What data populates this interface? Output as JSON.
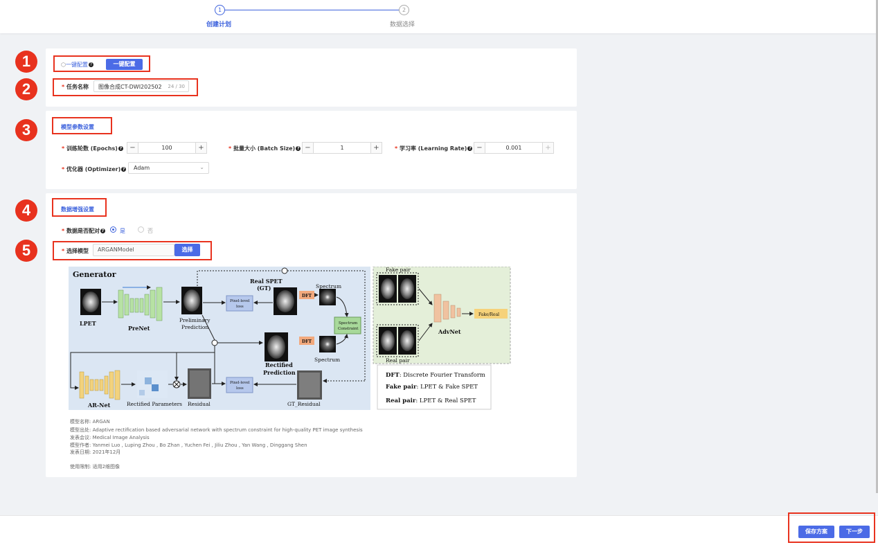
{
  "steps": [
    {
      "num": "1",
      "label": "创建计划"
    },
    {
      "num": "2",
      "label": "数据选择"
    }
  ],
  "badges": [
    "1",
    "2",
    "3",
    "4",
    "5"
  ],
  "quick_config": {
    "label": "一键配置",
    "icon": "cube-icon",
    "button": "一键配置"
  },
  "task": {
    "label": "任务名称",
    "value": "图像合成CT-DWI202502",
    "count": "24 / 30"
  },
  "model_params": {
    "title": "模型参数设置",
    "epochs": {
      "label": "训练轮数 (Epochs)",
      "value": "100"
    },
    "batch_size": {
      "label": "批量大小 (Batch Size)",
      "value": "1"
    },
    "learning_rate": {
      "label": "学习率 (Learning Rate)",
      "value": "0.001"
    },
    "optimizer": {
      "label": "优化器 (Optimizer)",
      "value": "Adam"
    }
  },
  "data_enhance": {
    "title": "数据增强设置",
    "paired": {
      "label": "数据是否配对",
      "yes": "是",
      "no": "否",
      "selected": "是"
    },
    "model_select": {
      "label": "选择模型",
      "value": "ARGANModel",
      "button": "选择"
    }
  },
  "diagram": {
    "generator": "Generator",
    "lpet": "LPET",
    "prenet": "PreNet",
    "preliminary": "Preliminary",
    "prediction": "Prediction",
    "real_spet": "Real SPET",
    "gt": "(GT)",
    "spectrum": "Spectrum",
    "dft": "DFT",
    "pixel_level": "Pixel-level",
    "loss": "loss",
    "spectrum_constraint_1": "Spectrum",
    "spectrum_constraint_2": "Constraint",
    "rectified": "Rectified",
    "ar_net": "AR-Net",
    "rectified_parameters": "Rectified Parameters",
    "residual": "Residual",
    "gt_residual": "GT_Residual",
    "fake_pair": "Fake pair",
    "real_pair": "Real pair",
    "advnet": "AdvNet",
    "fake_real": "Fake/Real",
    "legend_dft_key": "DFT",
    "legend_dft_val": ": Discrete Fourier Transform",
    "legend_fake_key": "Fake pair",
    "legend_fake_val": ": LPET & Fake SPET",
    "legend_real_key": "Real pair",
    "legend_real_val": ": LPET & Real SPET"
  },
  "model_info": {
    "name": "模型名称:  ARGAN",
    "source": "模型出处:  Adaptive rectification based adversarial network with spectrum constraint for high-quality PET image synthesis",
    "conference": "发表会议:  Medical Image Analysis",
    "authors": "模型作者:  Yanmei Luo , Luping Zhou , Bo Zhan , Yuchen Fei , Jiliu Zhou , Yan Wang , Dinggang Shen",
    "date": "发表日期:  2021年12月",
    "limit": "使用限制:  适用2维图像"
  },
  "footer": {
    "save": "保存方案",
    "next": "下一步"
  },
  "colors": {
    "accent": "#4b6be6",
    "annotation": "#e8321e"
  }
}
